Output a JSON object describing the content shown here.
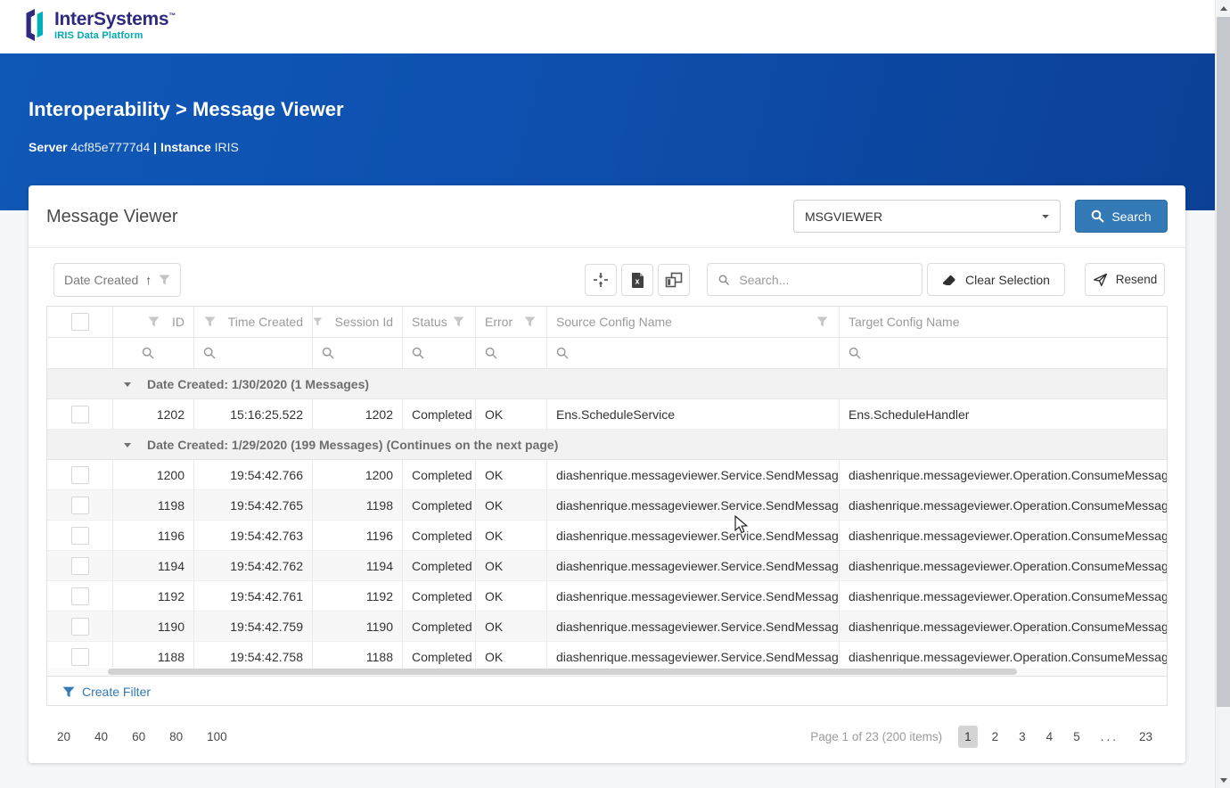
{
  "topbar": {
    "brand": "InterSystems",
    "trademark": "™",
    "product": "IRIS Data Platform"
  },
  "hero": {
    "breadcrumb": "Interoperability > Message Viewer",
    "server_label": "Server",
    "server_value": "4cf85e7777d4",
    "divider": "|",
    "instance_label": "Instance",
    "instance_value": "IRIS"
  },
  "panel": {
    "title": "Message Viewer",
    "viewer_dropdown_value": "MSGVIEWER",
    "search_button_label": "Search"
  },
  "toolbar": {
    "group_chip_label": "Date Created",
    "sort_arrow": "↑",
    "search_placeholder": "Search...",
    "clear_selection_label": "Clear Selection",
    "resend_label": "Resend"
  },
  "grid": {
    "columns": [
      {
        "label": "ID"
      },
      {
        "label": "Time Created"
      },
      {
        "label": "Session Id"
      },
      {
        "label": "Status"
      },
      {
        "label": "Error"
      },
      {
        "label": "Source Config Name"
      },
      {
        "label": "Target Config Name"
      }
    ],
    "groups": [
      {
        "label": "Date Created: 1/30/2020 (1 Messages)"
      },
      {
        "label": "Date Created: 1/29/2020 (199 Messages) (Continues on the next page)"
      }
    ],
    "rows": [
      {
        "id": "1202",
        "time": "15:16:25.522",
        "session": "1202",
        "status": "Completed",
        "error": "OK",
        "source": "Ens.ScheduleService",
        "target": "Ens.ScheduleHandler"
      },
      {
        "id": "1200",
        "time": "19:54:42.766",
        "session": "1200",
        "status": "Completed",
        "error": "OK",
        "source": "diashenrique.messageviewer.Service.SendMessage",
        "target": "diashenrique.messageviewer.Operation.ConsumeMessageC"
      },
      {
        "id": "1198",
        "time": "19:54:42.765",
        "session": "1198",
        "status": "Completed",
        "error": "OK",
        "source": "diashenrique.messageviewer.Service.SendMessage",
        "target": "diashenrique.messageviewer.Operation.ConsumeMessageC"
      },
      {
        "id": "1196",
        "time": "19:54:42.763",
        "session": "1196",
        "status": "Completed",
        "error": "OK",
        "source": "diashenrique.messageviewer.Service.SendMessage",
        "target": "diashenrique.messageviewer.Operation.ConsumeMessageC"
      },
      {
        "id": "1194",
        "time": "19:54:42.762",
        "session": "1194",
        "status": "Completed",
        "error": "OK",
        "source": "diashenrique.messageviewer.Service.SendMessage",
        "target": "diashenrique.messageviewer.Operation.ConsumeMessageC"
      },
      {
        "id": "1192",
        "time": "19:54:42.761",
        "session": "1192",
        "status": "Completed",
        "error": "OK",
        "source": "diashenrique.messageviewer.Service.SendMessage",
        "target": "diashenrique.messageviewer.Operation.ConsumeMessageC"
      },
      {
        "id": "1190",
        "time": "19:54:42.759",
        "session": "1190",
        "status": "Completed",
        "error": "OK",
        "source": "diashenrique.messageviewer.Service.SendMessage",
        "target": "diashenrique.messageviewer.Operation.ConsumeMessageC"
      },
      {
        "id": "1188",
        "time": "19:54:42.758",
        "session": "1188",
        "status": "Completed",
        "error": "OK",
        "source": "diashenrique.messageviewer.Service.SendMessage",
        "target": "diashenrique.messageviewer.Operation.ConsumeMessageC"
      }
    ],
    "create_filter_label": "Create Filter"
  },
  "pagination": {
    "page_sizes": [
      "20",
      "40",
      "60",
      "80",
      "100"
    ],
    "info": "Page 1 of 23 (200 items)",
    "pages": [
      "1",
      "2",
      "3",
      "4",
      "5",
      "...",
      "23"
    ],
    "current_page": "1"
  },
  "colors": {
    "accent_blue": "#337ab7",
    "hero_blue": "#0e4fae",
    "brand_navy": "#2e2a80",
    "brand_teal": "#00a9b4"
  }
}
